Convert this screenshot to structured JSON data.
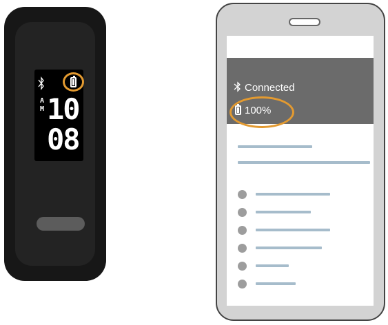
{
  "band": {
    "time_period": [
      "A",
      "M"
    ],
    "hour": "10",
    "minute": "08",
    "icons": {
      "bluetooth": "bluetooth-icon",
      "battery": "battery-icon"
    }
  },
  "phone": {
    "connection_label": "Connected",
    "battery_label": "100%",
    "list_item_count": 6
  },
  "colors": {
    "highlight": "#e39a30",
    "panel": "#6b6b6b",
    "placeholder_line": "#a6bccb",
    "list_dot": "#9d9d9d"
  }
}
